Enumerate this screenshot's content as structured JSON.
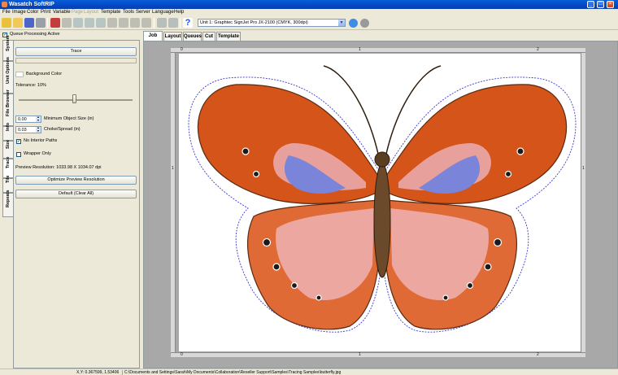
{
  "window": {
    "title": "Wasatch SoftRIP"
  },
  "menu": [
    "File",
    "Image",
    "Color",
    "Print",
    "Variable",
    "Page",
    "Layout",
    "Template",
    "Tools",
    "Server",
    "Language",
    "Help"
  ],
  "menu_disabled": [
    "Page",
    "Layout"
  ],
  "toolbar": {
    "unit_selector": "Unit 1: Graphtec  SignJet Pro JX-2100 (CMYK, 300dpi)"
  },
  "queue": {
    "label": "Queue Processing Active",
    "checked": true
  },
  "side_tabs": [
    "System",
    "Unit Options",
    "File Browser",
    "Info",
    "Size",
    "Trace",
    "Tile",
    "Repeats"
  ],
  "trace_panel": {
    "trace_button": "Trace",
    "background_color_label": "Background Color",
    "tolerance_label": "Tolerance: 10%",
    "min_object_size_value": "0.00",
    "min_object_size_label": "Minimum Object Size (in)",
    "choke_spread_value": "0.03",
    "choke_spread_label": "Choke/Spread (in)",
    "no_interior_paths_label": "No Interior Paths",
    "no_interior_paths_checked": true,
    "wrapper_only_label": "Wrapper Only",
    "wrapper_only_checked": false,
    "preview_resolution": "Preview Resolution: 1033.98 X 1034.07 dpi",
    "optimize_button": "Optimize Preview Resolution",
    "default_button": "Default (Clear All)"
  },
  "main_tabs": [
    "Job",
    "Layout",
    "Queues",
    "Cut",
    "Template"
  ],
  "active_tab": "Job",
  "rulers": {
    "top": [
      "0",
      "1",
      "2"
    ],
    "bottom": [
      "0",
      "1",
      "2"
    ],
    "left": [
      "1"
    ],
    "right": [
      "1"
    ]
  },
  "status": {
    "coords": "X,Y: 0.367599, 1.53406",
    "path": "C:\\Documents and Settings\\Sarah\\My Documents\\Collaboration\\Reseller Support\\Samples\\Tracing Samples\\butterfly.jpg"
  },
  "colors": {
    "title_bar": "#0347c6",
    "wing_orange": "#d4541a",
    "wing_pink": "#e8a09c",
    "wing_blue": "#7a84d8",
    "cut_line": "#3a3ad0"
  }
}
